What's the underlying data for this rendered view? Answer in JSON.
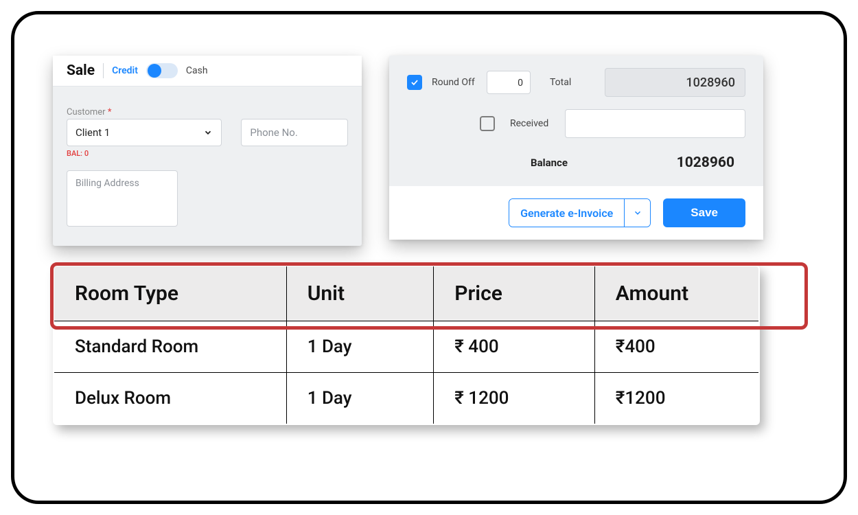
{
  "sale": {
    "title": "Sale",
    "credit_label": "Credit",
    "cash_label": "Cash",
    "customer_label": "Customer",
    "customer_value": "Client 1",
    "phone_placeholder": "Phone No.",
    "bal_text": "BAL: 0",
    "billing_placeholder": "Billing Address"
  },
  "totals": {
    "roundoff_label": "Round Off",
    "roundoff_value": "0",
    "total_label": "Total",
    "total_value": "1028960",
    "received_label": "Received",
    "received_value": "",
    "balance_label": "Balance",
    "balance_value": "1028960",
    "generate_label": "Generate e-Invoice",
    "save_label": "Save"
  },
  "table": {
    "columns": [
      "Room Type",
      "Unit",
      "Price",
      "Amount"
    ],
    "rows": [
      {
        "room": "Standard Room",
        "unit": "1 Day",
        "price": "₹  400",
        "amount": "₹400"
      },
      {
        "room": "Delux Room",
        "unit": "1 Day",
        "price": "₹ 1200",
        "amount": "₹1200"
      }
    ]
  }
}
